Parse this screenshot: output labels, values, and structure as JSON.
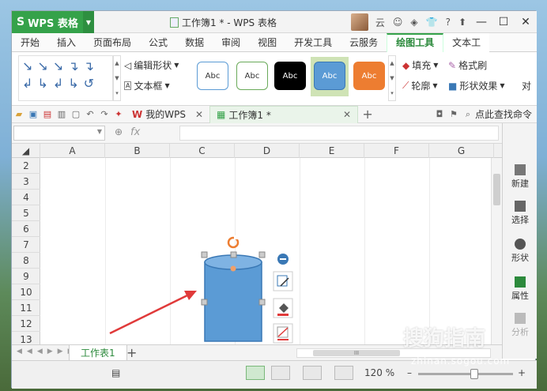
{
  "app": {
    "name": "WPS 表格",
    "logo": "S",
    "window_title": "工作簿1 * - WPS 表格",
    "user_label": "云"
  },
  "titlebar": {
    "help": "?",
    "minimize": "—",
    "maximize": "☐",
    "close": "✕"
  },
  "tabs": [
    "开始",
    "插入",
    "页面布局",
    "公式",
    "数据",
    "审阅",
    "视图",
    "开发工具",
    "云服务",
    "绘图工具",
    "文本工"
  ],
  "active_tab_index": 9,
  "ribbon": {
    "edit_shape": "编辑形状",
    "text_box": "文本框",
    "style_label": "Abc",
    "fill": "填充",
    "format_painter": "格式刷",
    "outline": "轮廓",
    "shape_effect": "形状效果",
    "more_char": "对"
  },
  "toolbar": {
    "my_wps": "我的WPS",
    "doc_tab": "工作簿1 *",
    "find_cmd": "点此查找命令"
  },
  "formula_bar": {
    "fx": "fx"
  },
  "columns": [
    "A",
    "B",
    "C",
    "D",
    "E",
    "F",
    "G"
  ],
  "rows": [
    "2",
    "3",
    "4",
    "5",
    "6",
    "7",
    "8",
    "9",
    "10",
    "11",
    "12",
    "13"
  ],
  "side_panel": {
    "new": "新建",
    "select": "选择",
    "shape": "形状",
    "properties": "属性",
    "analyze": "分析"
  },
  "sheet": {
    "tab": "工作表1",
    "add": "+"
  },
  "status": {
    "zoom": "120 %"
  },
  "watermark": {
    "text": "搜狗指南",
    "url": "zhinan.sogou.com"
  },
  "colors": {
    "brand_green": "#35a24a",
    "shape_blue": "#5b9bd5",
    "arrow_red": "#e03a3a"
  }
}
